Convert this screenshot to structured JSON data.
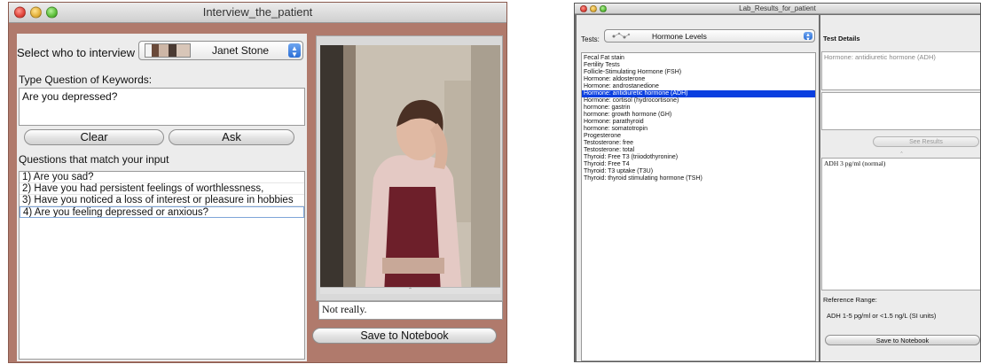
{
  "interview_window": {
    "title": "Interview_the_patient",
    "select_label": "Select who to interview",
    "patient_name": "Janet Stone",
    "question_label": "Type Question of Keywords:",
    "question_value": "Are you depressed?",
    "clear_label": "Clear",
    "ask_label": "Ask",
    "matches_label": "Questions that match your input",
    "matches": [
      "1) Are you sad?",
      "2) Have you had persistent feelings of worthlessness,",
      "3) Have you noticed a loss of interest or pleasure in hobbies",
      "4) Are you feeling depressed or anxious?"
    ],
    "answer_text": "Not really.",
    "save_label": "Save to Notebook"
  },
  "lab_window": {
    "title": "Lab_Results_for_patient",
    "tests_label": "Tests:",
    "tests_selected": "Hormone Levels",
    "tests": [
      "Fecal Fat stain",
      "Fertility Tests",
      "Follicle-Stimulating Hormone (FSH)",
      "Hormone: aldosterone",
      "Hormone: androstanedione",
      "Hormone: antidiuretic hormone (ADH)",
      "Hormone: cortisol (hydrocortisone)",
      "hormone: gastrin",
      "hormone: growth hormone (GH)",
      "Hormone: parathyroid",
      "hormone: somatotropin",
      "Progesterone",
      "Testosterone: free",
      "Testosterone: total",
      "Thyroid: Free T3 (triiodothyronine)",
      "Thyroid: Free T4",
      "Thyroid: T3 uptake (T3U)",
      "Thyroid: thyroid stimulating hormone (TSH)"
    ],
    "selected_test_index": 5,
    "details_title": "Test Details",
    "detail_name": "Hormone: antidiuretic hormone (ADH)",
    "see_results_label": "See Results",
    "result_text": "ADH 3 pg/ml (normal)",
    "reference_label": "Reference Range:",
    "reference_value": "ADH 1-5 pg/ml or <1.5 ng/L (SI units)",
    "save_label": "Save to Notebook"
  }
}
